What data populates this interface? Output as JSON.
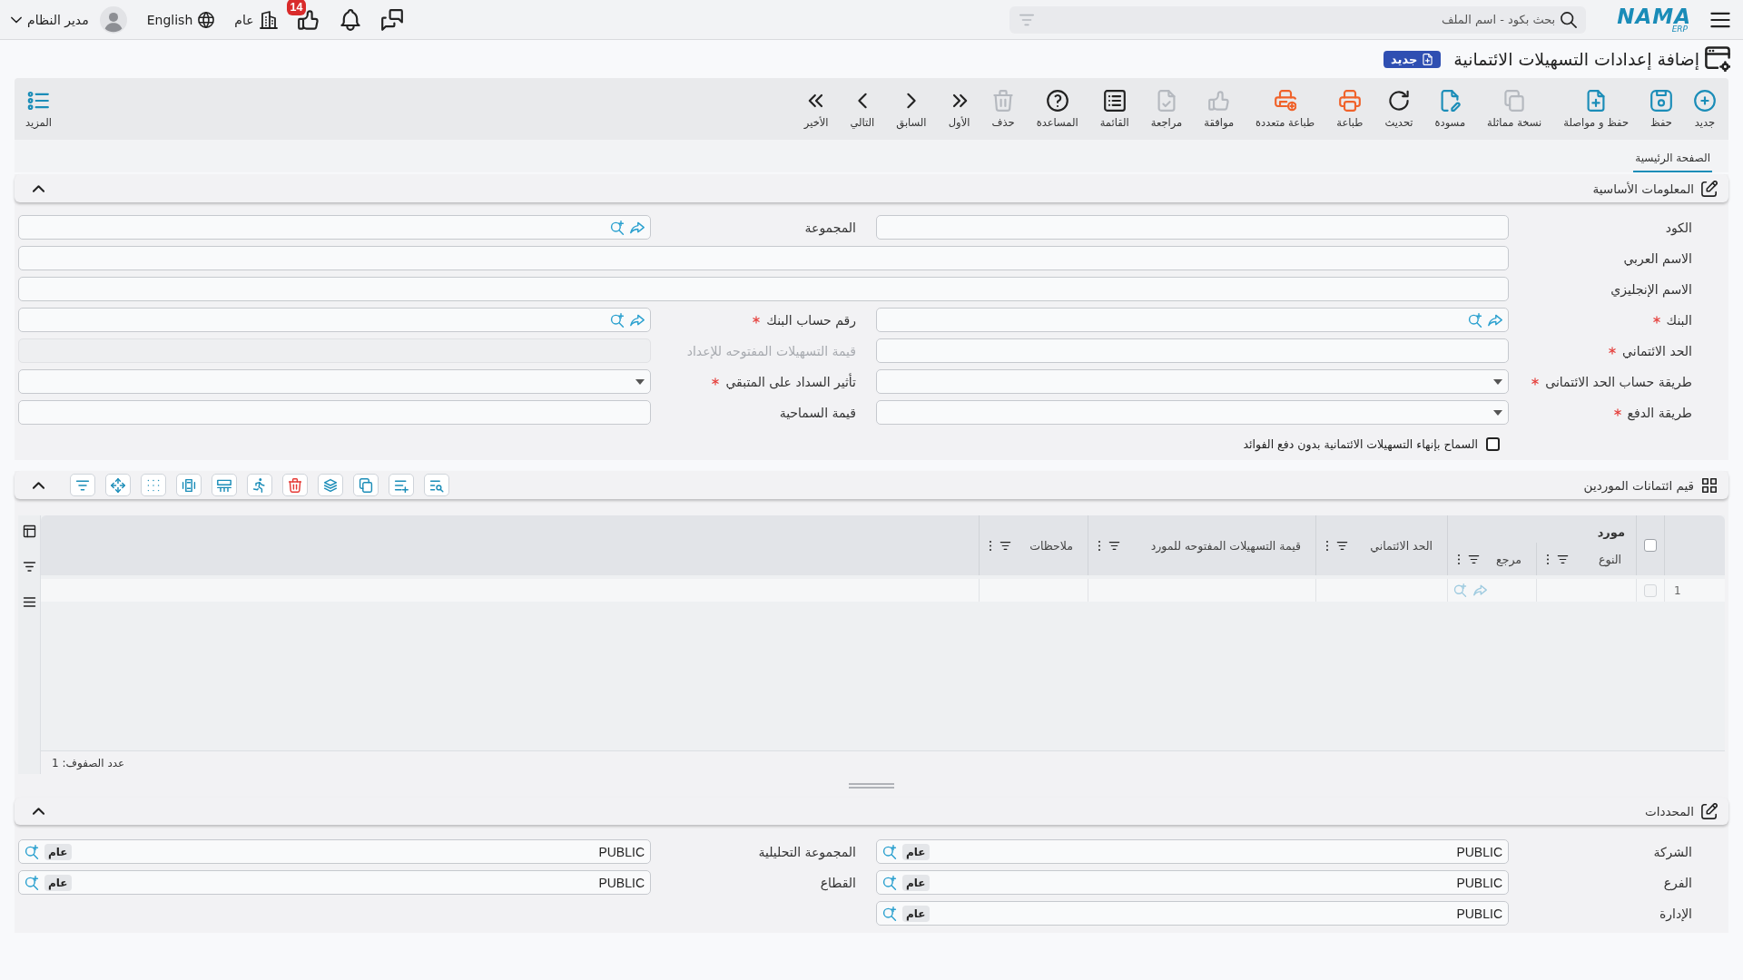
{
  "top_bar": {
    "logo": {
      "name": "NAMA",
      "suffix": "ERP"
    },
    "search": {
      "placeholder": "بحث بكود - اسم الملف"
    },
    "notification_count": "14",
    "company": "عام",
    "language": "English",
    "user": "مدير النظام"
  },
  "page": {
    "title": "إضافة إعدادات التسهيلات الائتمانية",
    "status": "جديد"
  },
  "toolbar": {
    "buttons": [
      {
        "label": "جديد",
        "disabled": false
      },
      {
        "label": "حفظ",
        "disabled": false
      },
      {
        "label": "حفظ و مواصلة",
        "disabled": false
      },
      {
        "label": "نسخة مماثلة",
        "disabled": true
      },
      {
        "label": "مسودة",
        "disabled": false
      },
      {
        "label": "تحديث",
        "disabled": false
      },
      {
        "label": "طباعة",
        "disabled": false
      },
      {
        "label": "طباعة متعددة",
        "disabled": false
      },
      {
        "label": "موافقة",
        "disabled": true
      },
      {
        "label": "مراجعة",
        "disabled": true
      },
      {
        "label": "القائمة",
        "disabled": false
      },
      {
        "label": "المساعدة",
        "disabled": false
      },
      {
        "label": "حذف",
        "disabled": true
      },
      {
        "label": "الأول",
        "disabled": false
      },
      {
        "label": "السابق",
        "disabled": false
      },
      {
        "label": "التالي",
        "disabled": false
      },
      {
        "label": "الأخير",
        "disabled": false
      }
    ],
    "more": "المزيد"
  },
  "tabs": [
    {
      "label": "الصفحة الرئيسية",
      "selected": true
    }
  ],
  "basic_info": {
    "title": "المعلومات الأساسية",
    "expanded": true,
    "rows": [
      {
        "fields": [
          {
            "label": "الكود",
            "kind": "text",
            "required": false,
            "disabled": false
          },
          {
            "label": "المجموعة",
            "kind": "lookup",
            "required": false,
            "disabled": false
          }
        ]
      },
      {
        "fields": [
          {
            "label": "الاسم العربي",
            "kind": "text",
            "required": false,
            "disabled": false
          }
        ]
      },
      {
        "fields": [
          {
            "label": "الاسم الإنجليزي",
            "kind": "text",
            "required": false,
            "disabled": false
          }
        ]
      },
      {
        "fields": [
          {
            "label": "البنك",
            "kind": "lookup",
            "required": true,
            "disabled": false
          },
          {
            "label": "رقم حساب البنك",
            "kind": "lookup",
            "required": true,
            "disabled": false
          }
        ]
      },
      {
        "fields": [
          {
            "label": "الحد الائتماني",
            "kind": "text",
            "required": true,
            "disabled": false
          },
          {
            "label": "قيمة التسهيلات المفتوحه للإعداد",
            "kind": "text",
            "required": false,
            "disabled": true
          }
        ]
      },
      {
        "fields": [
          {
            "label": "طريقة حساب الحد الائتمانى",
            "kind": "select",
            "required": true,
            "disabled": false
          },
          {
            "label": "تأثير السداد على المتبقي",
            "kind": "select",
            "required": true,
            "disabled": false
          }
        ]
      },
      {
        "fields": [
          {
            "label": "طريقة الدفع",
            "kind": "select",
            "required": true,
            "disabled": false
          },
          {
            "label": "قيمة السماحية",
            "kind": "text",
            "required": false,
            "disabled": false
          }
        ]
      }
    ],
    "checkbox": {
      "label": "السماح بإنهاء التسهيلات الائتمانية بدون دفع الفوائد",
      "checked": false
    }
  },
  "supplier_credits": {
    "title": "قيم ائتمانات الموردين",
    "expanded": true,
    "header_checkbox": {
      "checked": false
    },
    "columns": [
      {
        "label": "مورد",
        "children": [
          {
            "label": "النوع",
            "lookup": false
          },
          {
            "label": "مرجع",
            "lookup": true
          }
        ]
      },
      {
        "label": "الحد الائتماني",
        "lookup": false
      },
      {
        "label": "قيمة التسهيلات المفتوحه للمورد",
        "lookup": false
      },
      {
        "label": "ملاحظات",
        "lookup": false
      }
    ],
    "rows": [
      {
        "number": "1",
        "selected": false
      }
    ],
    "row_count": "عدد الصفوف: 1"
  },
  "dimensions": {
    "title": "المحددات",
    "expanded": true,
    "fields": [
      {
        "label": "الشركة",
        "value": "PUBLIC",
        "tag": "عام"
      },
      {
        "label": "المجموعة التحليلية",
        "value": "PUBLIC",
        "tag": "عام"
      },
      {
        "label": "الفرع",
        "value": "PUBLIC",
        "tag": "عام"
      },
      {
        "label": "القطاع",
        "value": "PUBLIC",
        "tag": "عام"
      },
      {
        "label": "الإدارة",
        "value": "PUBLIC",
        "tag": "عام"
      }
    ]
  }
}
